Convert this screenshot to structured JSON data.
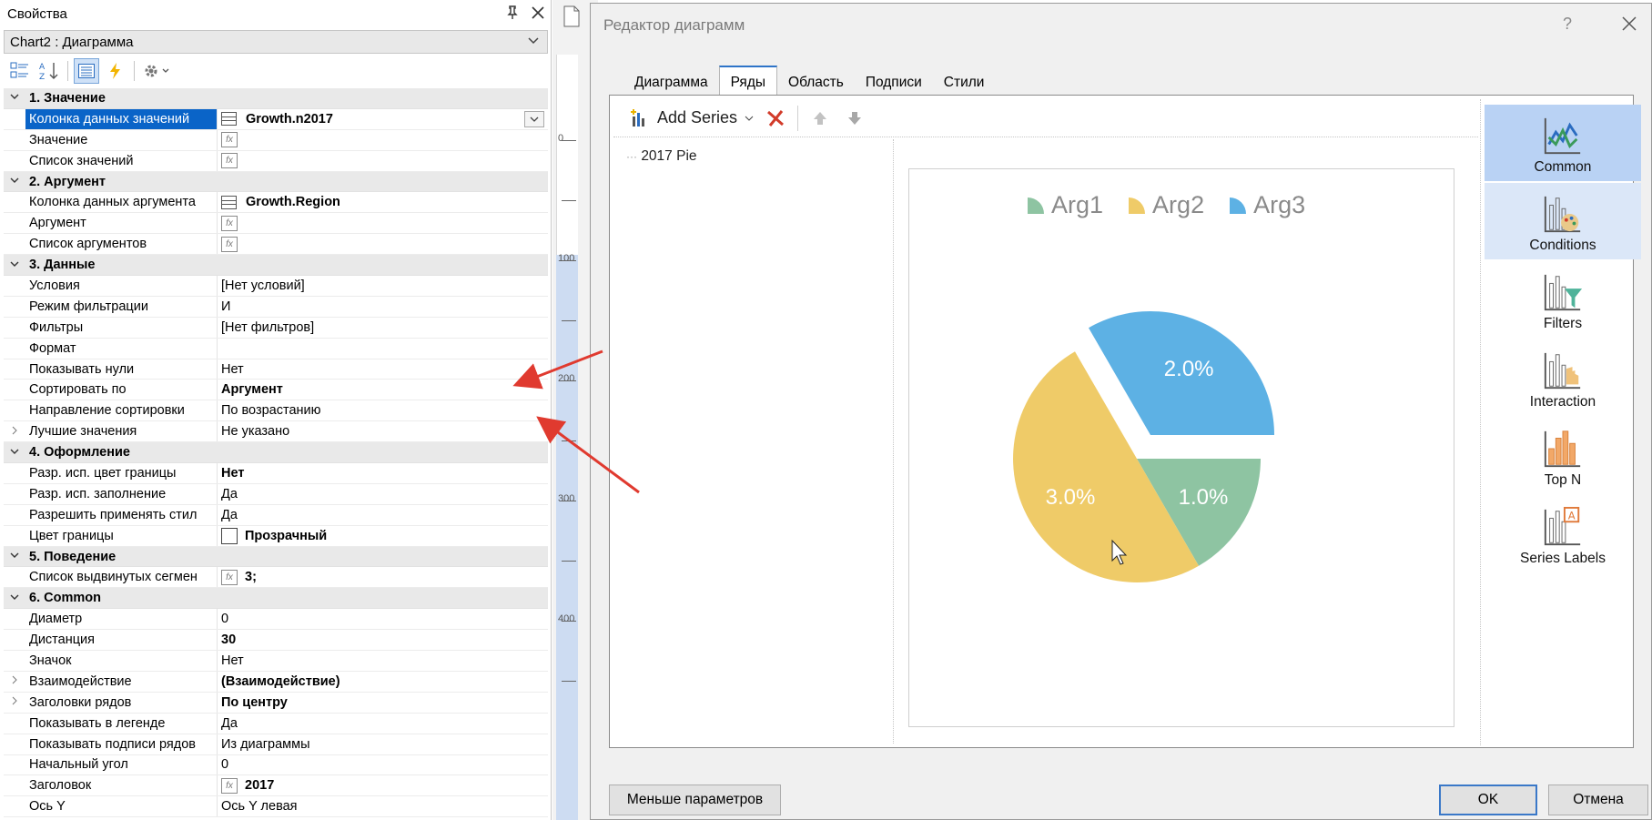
{
  "properties": {
    "title": "Свойства",
    "object": "Chart2 : Диаграмма",
    "categories": [
      {
        "title": "1. Значение",
        "rows": [
          {
            "name": "Колонка данных значений",
            "value": "Growth.n2017",
            "bold": true,
            "icon": "table",
            "selected": true,
            "dropdown": true
          },
          {
            "name": "Значение",
            "value": "",
            "icon": "fx"
          },
          {
            "name": "Список значений",
            "value": "",
            "icon": "fx"
          }
        ]
      },
      {
        "title": "2. Аргумент",
        "rows": [
          {
            "name": "Колонка данных аргумента",
            "value": "Growth.Region",
            "bold": true,
            "icon": "table"
          },
          {
            "name": "Аргумент",
            "value": "",
            "icon": "fx"
          },
          {
            "name": "Список аргументов",
            "value": "",
            "icon": "fx"
          }
        ]
      },
      {
        "title": "3. Данные",
        "rows": [
          {
            "name": "Условия",
            "value": "[Нет условий]"
          },
          {
            "name": "Режим фильтрации",
            "value": "И"
          },
          {
            "name": "Фильтры",
            "value": "[Нет фильтров]"
          },
          {
            "name": "Формат",
            "value": ""
          },
          {
            "name": "Показывать нули",
            "value": "Нет"
          },
          {
            "name": "Сортировать по",
            "value": "Аргумент",
            "bold": true
          },
          {
            "name": "Направление сортировки",
            "value": "По возрастанию"
          },
          {
            "name": "Лучшие значения",
            "value": "Не указано",
            "expandable": true
          }
        ]
      },
      {
        "title": "4. Оформление",
        "rows": [
          {
            "name": "Разр. исп. цвет границы",
            "value": "Нет",
            "bold": true
          },
          {
            "name": "Разр. исп. заполнение",
            "value": "Да"
          },
          {
            "name": "Разрешить применять стил",
            "value": "Да"
          },
          {
            "name": "Цвет границы",
            "value": "Прозрачный",
            "bold": true,
            "icon": "swatch"
          }
        ]
      },
      {
        "title": "5. Поведение",
        "rows": [
          {
            "name": "Список выдвинутых сегмен",
            "value": "3;",
            "bold": true,
            "icon": "fx"
          }
        ]
      },
      {
        "title": "6. Common",
        "rows": [
          {
            "name": "Диаметр",
            "value": "0"
          },
          {
            "name": "Дистанция",
            "value": "30",
            "bold": true
          },
          {
            "name": "Значок",
            "value": "Нет"
          },
          {
            "name": "Взаимодействие",
            "value": "(Взаимодействие)",
            "bold": true,
            "expandable": true
          },
          {
            "name": "Заголовки рядов",
            "value": "По центру",
            "bold": true,
            "expandable": true
          },
          {
            "name": "Показывать в легенде",
            "value": "Да"
          },
          {
            "name": "Показывать подписи рядов",
            "value": "Из диаграммы"
          },
          {
            "name": "Начальный угол",
            "value": "0"
          },
          {
            "name": "Заголовок",
            "value": "2017",
            "bold": true,
            "icon": "fx"
          },
          {
            "name": "Ось Y",
            "value": "Ось Y левая"
          }
        ]
      }
    ]
  },
  "ruler": {
    "labels": [
      "0",
      "100",
      "200",
      "300",
      "400"
    ]
  },
  "dialog": {
    "title": "Редактор диаграмм",
    "help": "?",
    "tabs": [
      "Диаграмма",
      "Ряды",
      "Область",
      "Подписи",
      "Стили"
    ],
    "active_tab": "Ряды",
    "toolbar": {
      "add_series": "Add Series"
    },
    "series": [
      "2017 Pie"
    ],
    "right_panel": [
      {
        "label": "Common",
        "icon": "line-chart-icon",
        "state": "active"
      },
      {
        "label": "Conditions",
        "icon": "palette-chart-icon",
        "state": "hover"
      },
      {
        "label": "Filters",
        "icon": "funnel-chart-icon",
        "state": ""
      },
      {
        "label": "Interaction",
        "icon": "hand-chart-icon",
        "state": ""
      },
      {
        "label": "Top N",
        "icon": "bars-chart-icon",
        "state": ""
      },
      {
        "label": "Series Labels",
        "icon": "label-chart-icon",
        "state": ""
      }
    ],
    "buttons": {
      "less": "Меньше параметров",
      "ok": "OK",
      "cancel": "Отмена"
    }
  },
  "chart_data": {
    "type": "pie",
    "categories": [
      "Arg1",
      "Arg2",
      "Arg3"
    ],
    "values": [
      1.0,
      3.0,
      2.0
    ],
    "labels": [
      "1.0%",
      "3.0%",
      "2.0%"
    ],
    "colors": [
      "#8ec4a2",
      "#efcb68",
      "#5db1e4"
    ],
    "exploded": [
      "Arg3"
    ],
    "legend": "top-center"
  }
}
